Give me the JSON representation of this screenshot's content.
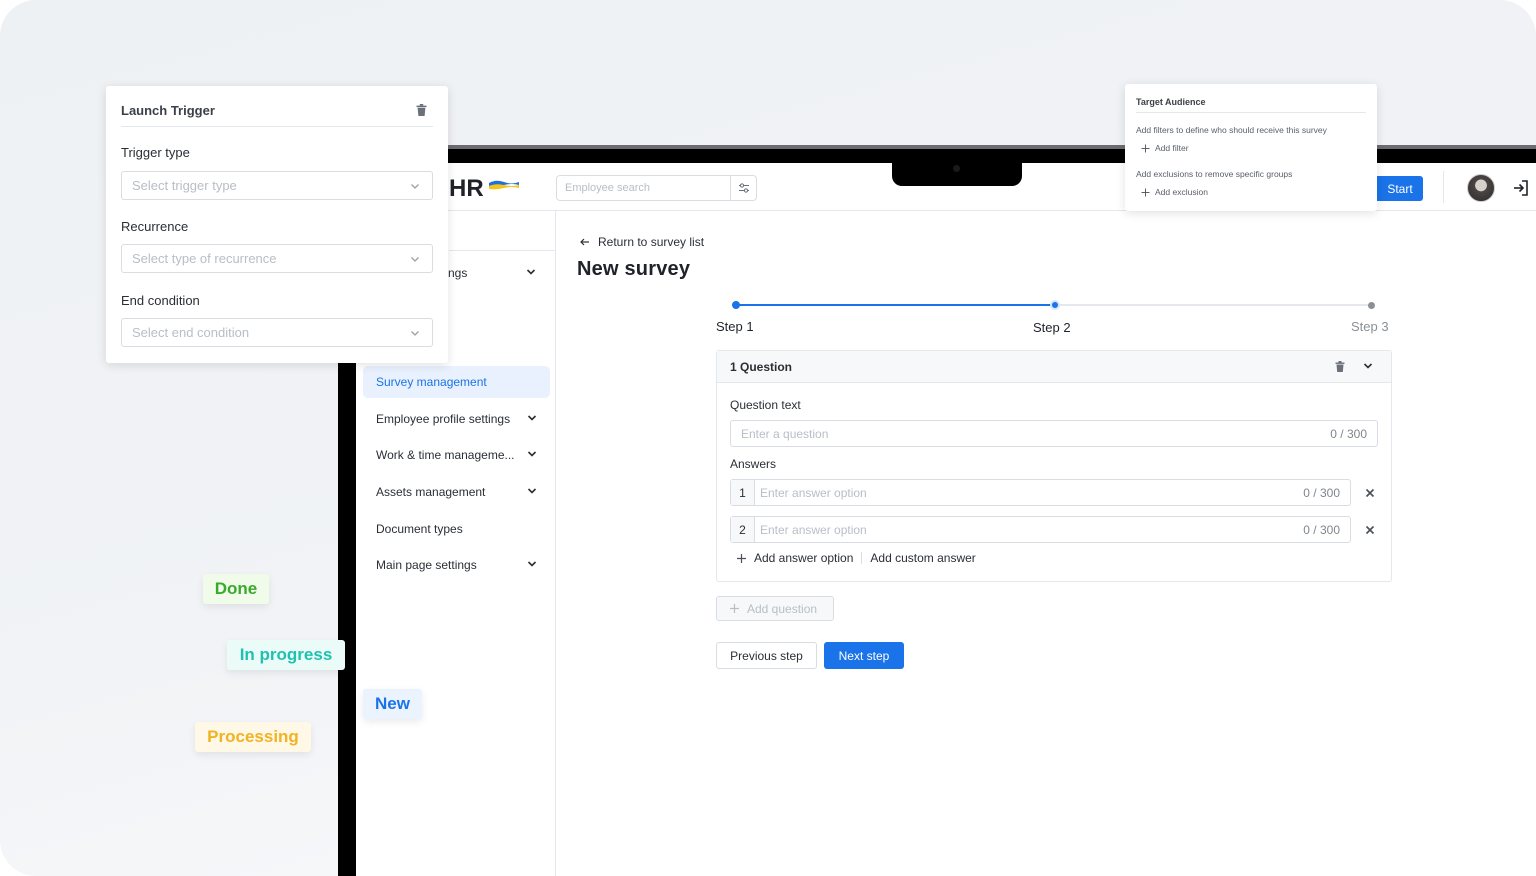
{
  "app": {
    "logo_text": "HR"
  },
  "header": {
    "search_placeholder": "Employee search",
    "start_label": "Start"
  },
  "sidebar": {
    "partial_item": "ngs",
    "items": [
      {
        "label": "Survey management",
        "active": true
      },
      {
        "label": "Employee profile settings",
        "has_children": true
      },
      {
        "label": "Work & time manageme...",
        "has_children": true
      },
      {
        "label": "Assets management",
        "has_children": true
      },
      {
        "label": "Document types",
        "has_children": false
      },
      {
        "label": "Main page settings",
        "has_children": true
      }
    ]
  },
  "main": {
    "back_link": "Return to survey list",
    "title": "New survey",
    "steps": [
      {
        "label": "Step 1",
        "state": "done"
      },
      {
        "label": "Step 2",
        "state": "current"
      },
      {
        "label": "Step 3",
        "state": "upcoming"
      }
    ],
    "question_card": {
      "title": "1 Question",
      "question_text_label": "Question text",
      "question_placeholder": "Enter a question",
      "question_counter": "0 / 300",
      "answers_label": "Answers",
      "answers": [
        {
          "num": "1",
          "placeholder": "Enter answer option",
          "counter": "0 / 300"
        },
        {
          "num": "2",
          "placeholder": "Enter answer option",
          "counter": "0 / 300"
        }
      ],
      "add_answer_option": "Add answer option",
      "add_custom_answer": "Add custom answer"
    },
    "add_question": "Add question",
    "previous_step": "Previous step",
    "next_step": "Next step"
  },
  "launch_trigger": {
    "title": "Launch Trigger",
    "trigger_type_label": "Trigger type",
    "trigger_type_placeholder": "Select trigger type",
    "recurrence_label": "Recurrence",
    "recurrence_placeholder": "Select type of recurrence",
    "end_condition_label": "End condition",
    "end_condition_placeholder": "Select end condition"
  },
  "target_audience": {
    "title": "Target Audience",
    "filters_text": "Add filters to define who should receive this survey",
    "add_filter": "Add filter",
    "exclusions_text": "Add exclusions to remove specific groups",
    "add_exclusion": "Add exclusion"
  },
  "status_tags": [
    {
      "label": "Done",
      "color": "#3aaa2e",
      "bg": "#f1fbe9"
    },
    {
      "label": "In progress",
      "color": "#1fc2b0",
      "bg": "#eafbf8"
    },
    {
      "label": "New",
      "color": "#1a73e8",
      "bg": "#eaf3fe"
    },
    {
      "label": "Processing",
      "color": "#f0b323",
      "bg": "#fff8e6"
    }
  ],
  "colors": {
    "primary": "#1a73e8",
    "border": "#d9dde3",
    "muted_text": "#b8bec6"
  }
}
